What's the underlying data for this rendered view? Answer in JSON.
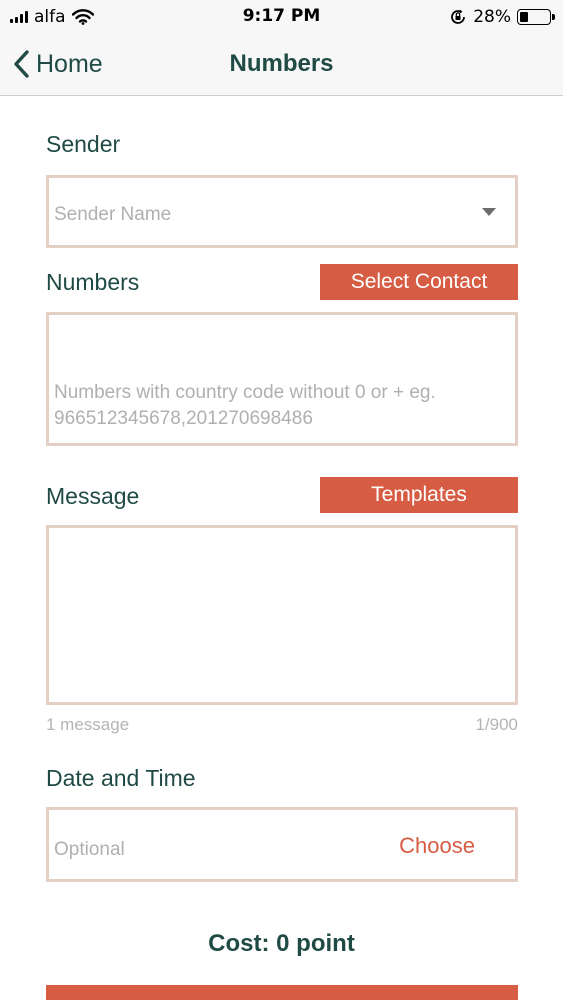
{
  "status_bar": {
    "carrier": "alfa",
    "time": "9:17 PM",
    "battery_percent": "28%",
    "battery_level": 0.28,
    "icons": [
      "signal-icon",
      "wifi-icon",
      "orientation-lock-icon",
      "battery-icon"
    ]
  },
  "nav": {
    "back_label": "Home",
    "title": "Numbers",
    "icons": [
      "chevron-left-icon"
    ]
  },
  "form": {
    "sender": {
      "label": "Sender",
      "placeholder": "Sender Name",
      "icons": [
        "dropdown-caret-icon"
      ]
    },
    "numbers": {
      "label": "Numbers",
      "select_contact_label": "Select Contact",
      "placeholder_line1": "Numbers with country code without 0 or + eg.",
      "placeholder_line2": "966512345678,201270698486"
    },
    "message": {
      "label": "Message",
      "templates_label": "Templates",
      "value": "",
      "count_label": "1 message",
      "char_counter": "1/900"
    },
    "datetime": {
      "label": "Date and Time",
      "placeholder": "Optional",
      "choose_label": "Choose"
    }
  },
  "cost": {
    "text": "Cost: 0 point"
  },
  "colors": {
    "accent": "#d65c43",
    "text_primary": "#1f4a45",
    "field_border": "#e3cfc3",
    "placeholder": "#b0b0b0"
  }
}
